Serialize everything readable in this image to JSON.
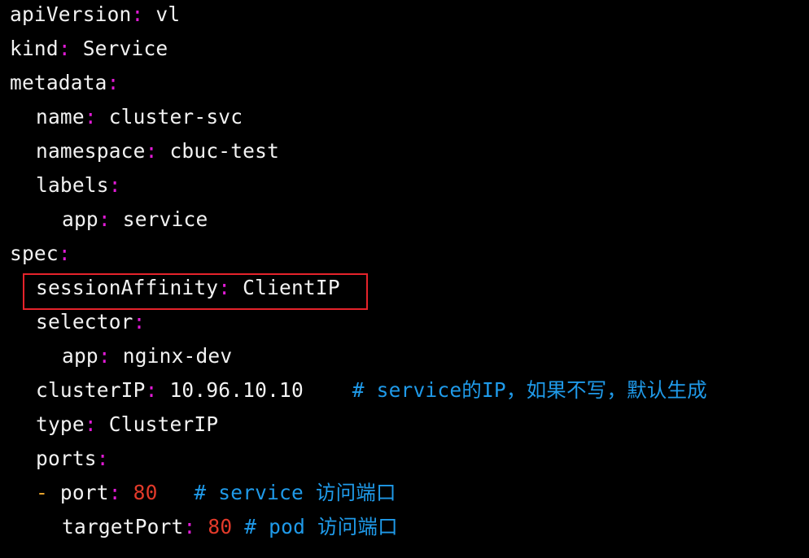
{
  "lines": [
    {
      "key": "apiVersion",
      "value": "vl"
    },
    {
      "key": "kind",
      "value": "Service"
    },
    {
      "key": "metadata"
    },
    {
      "key": "name",
      "value": "cluster-svc"
    },
    {
      "key": "namespace",
      "value": "cbuc-test"
    },
    {
      "key": "labels"
    },
    {
      "key": "app",
      "value": "service"
    },
    {
      "key": "spec"
    },
    {
      "key": "sessionAffinity",
      "value": "ClientIP"
    },
    {
      "key": "selector"
    },
    {
      "key": "app",
      "value": "nginx-dev"
    },
    {
      "key": "clusterIP",
      "value": "10.96.10.10",
      "comment": "# service的IP，如果不写，默认生成"
    },
    {
      "key": "type",
      "value": "ClusterIP"
    },
    {
      "key": "ports"
    },
    {
      "dash": "-",
      "key": "port",
      "value": "80",
      "comment": "# service 访问端口"
    },
    {
      "key": "targetPort",
      "value": "80",
      "comment": "# pod 访问端口"
    }
  ],
  "colors": {
    "background": "#000000",
    "key": "#f2f2f2",
    "colon": "#e11bd6",
    "number": "#e23a2a",
    "dash": "#e7a32c",
    "comment": "#1f9ae9",
    "highlight_border": "#e5232b"
  }
}
